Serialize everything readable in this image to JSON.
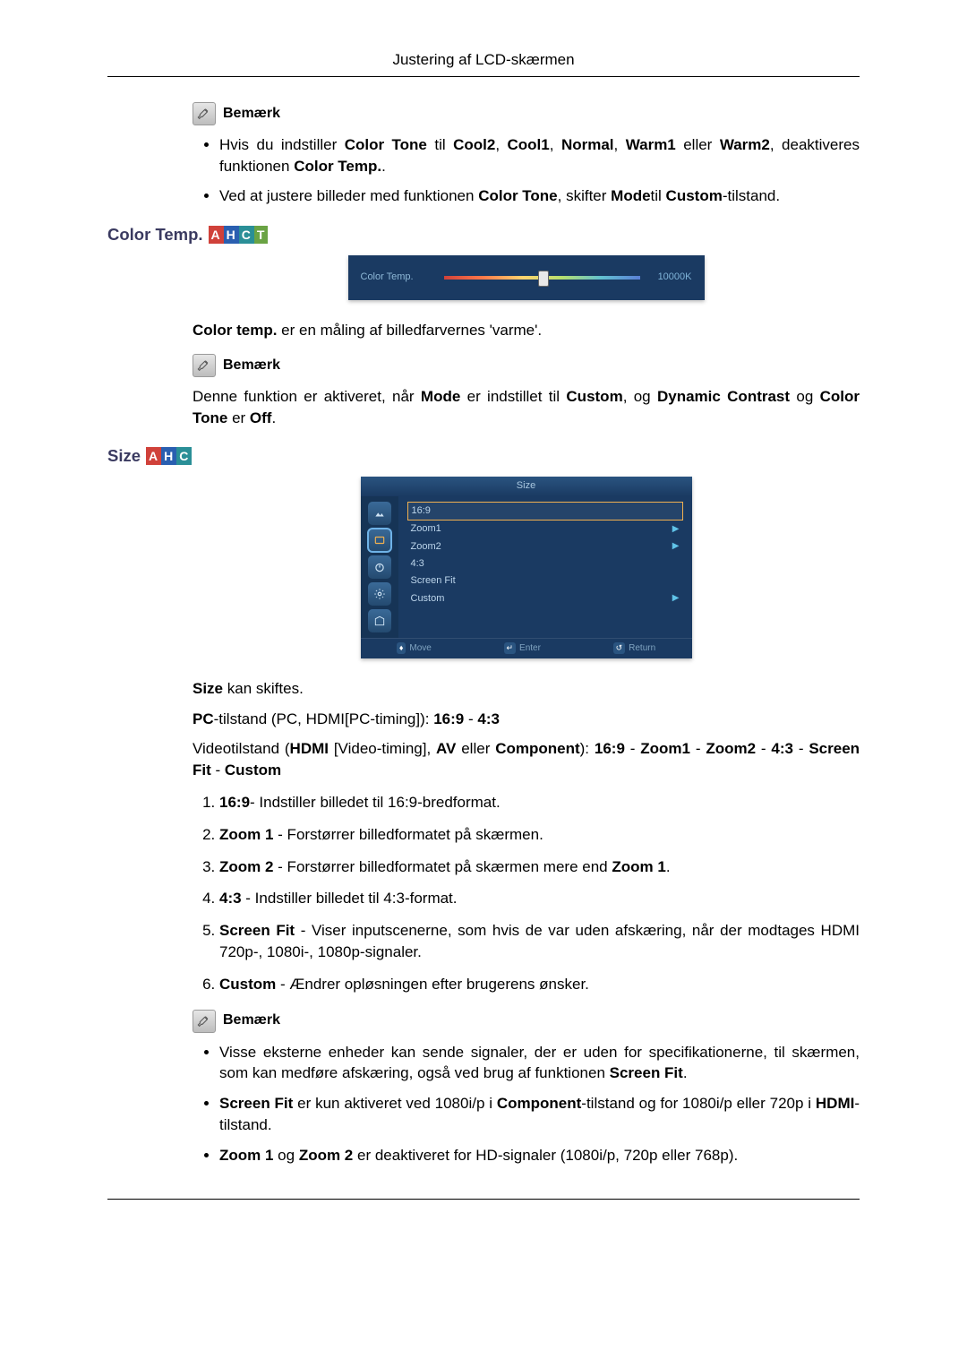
{
  "header": {
    "title": "Justering af LCD-skærmen"
  },
  "note_label": "Bemærk",
  "notes1": [
    {
      "html": "Hvis du indstiller <b>Color Tone</b> til <b>Cool2</b>, <b>Cool1</b>, <b>Normal</b>, <b>Warm1</b> eller <b>Warm2</b>, deaktiveres funktionen <b>Color Temp.</b>."
    },
    {
      "html": "Ved at justere billeder med funktionen <b>Color Tone</b>, skifter <b>Mode</b>til <b>Custom</b>-tilstand."
    }
  ],
  "color_temp": {
    "heading": "Color Temp.",
    "modes": [
      "A",
      "H",
      "C",
      "T"
    ],
    "panel": {
      "label": "Color Temp.",
      "value": "10000K"
    },
    "desc_html": "<b>Color temp.</b> er en måling af billedfarvernes 'varme'.",
    "note_html": "Denne funktion er aktiveret, når <b>Mode</b> er indstillet til <b>Custom</b>, og <b>Dynamic Contrast</b> og <b>Color Tone</b> er <b>Off</b>."
  },
  "size": {
    "heading": "Size",
    "modes": [
      "A",
      "H",
      "C"
    ],
    "panel": {
      "title": "Size",
      "items": [
        {
          "label": "16:9",
          "selected": true,
          "arrow": false
        },
        {
          "label": "Zoom1",
          "arrow": true
        },
        {
          "label": "Zoom2",
          "arrow": true
        },
        {
          "label": "4:3",
          "arrow": false
        },
        {
          "label": "Screen Fit",
          "arrow": false
        },
        {
          "label": "Custom",
          "arrow": true
        }
      ],
      "footer": {
        "move": "Move",
        "enter": "Enter",
        "return": "Return"
      }
    },
    "p1_html": "<b>Size</b> kan skiftes.",
    "p2_html": "<b>PC</b>-tilstand (PC, HDMI[PC-timing]): <b>16:9</b> - <b>4:3</b>",
    "p3_html": "Videotilstand (<b>HDMI</b> [Video-timing], <b>AV</b> eller <b>Component</b>): <b>16:9</b> - <b>Zoom1</b> - <b>Zoom2</b> - <b>4:3</b> - <b>Screen Fit</b> - <b>Custom</b>",
    "numlist": [
      {
        "html": "<b>16:9</b>- Indstiller billedet til 16:9-bredformat."
      },
      {
        "html": "<b>Zoom 1</b> - Forstørrer billedformatet på skærmen."
      },
      {
        "html": "<b>Zoom 2</b> - Forstørrer billedformatet på skærmen mere end <b>Zoom 1</b>."
      },
      {
        "html": "<b>4:3</b> - Indstiller billedet til 4:3-format."
      },
      {
        "html": "<b>Screen Fit</b> - Viser inputscenerne, som hvis de var uden afskæring, når der modtages HDMI 720p-, 1080i-, 1080p-signaler."
      },
      {
        "html": "<b>Custom</b> - Ændrer opløsningen efter brugerens ønsker."
      }
    ],
    "notes2": [
      {
        "html": "Visse eksterne enheder kan sende signaler, der er uden for specifikationerne, til skærmen, som kan medføre afskæring, også ved brug af funktionen <b>Screen Fit</b>."
      },
      {
        "html": "<b>Screen Fit</b> er kun aktiveret ved 1080i/p i <b>Component</b>-tilstand og for 1080i/p eller 720p i <b>HDMI</b>-tilstand."
      },
      {
        "html": "<b>Zoom 1</b> og <b>Zoom 2</b> er deaktiveret for HD-signaler (1080i/p, 720p eller 768p)."
      }
    ]
  }
}
